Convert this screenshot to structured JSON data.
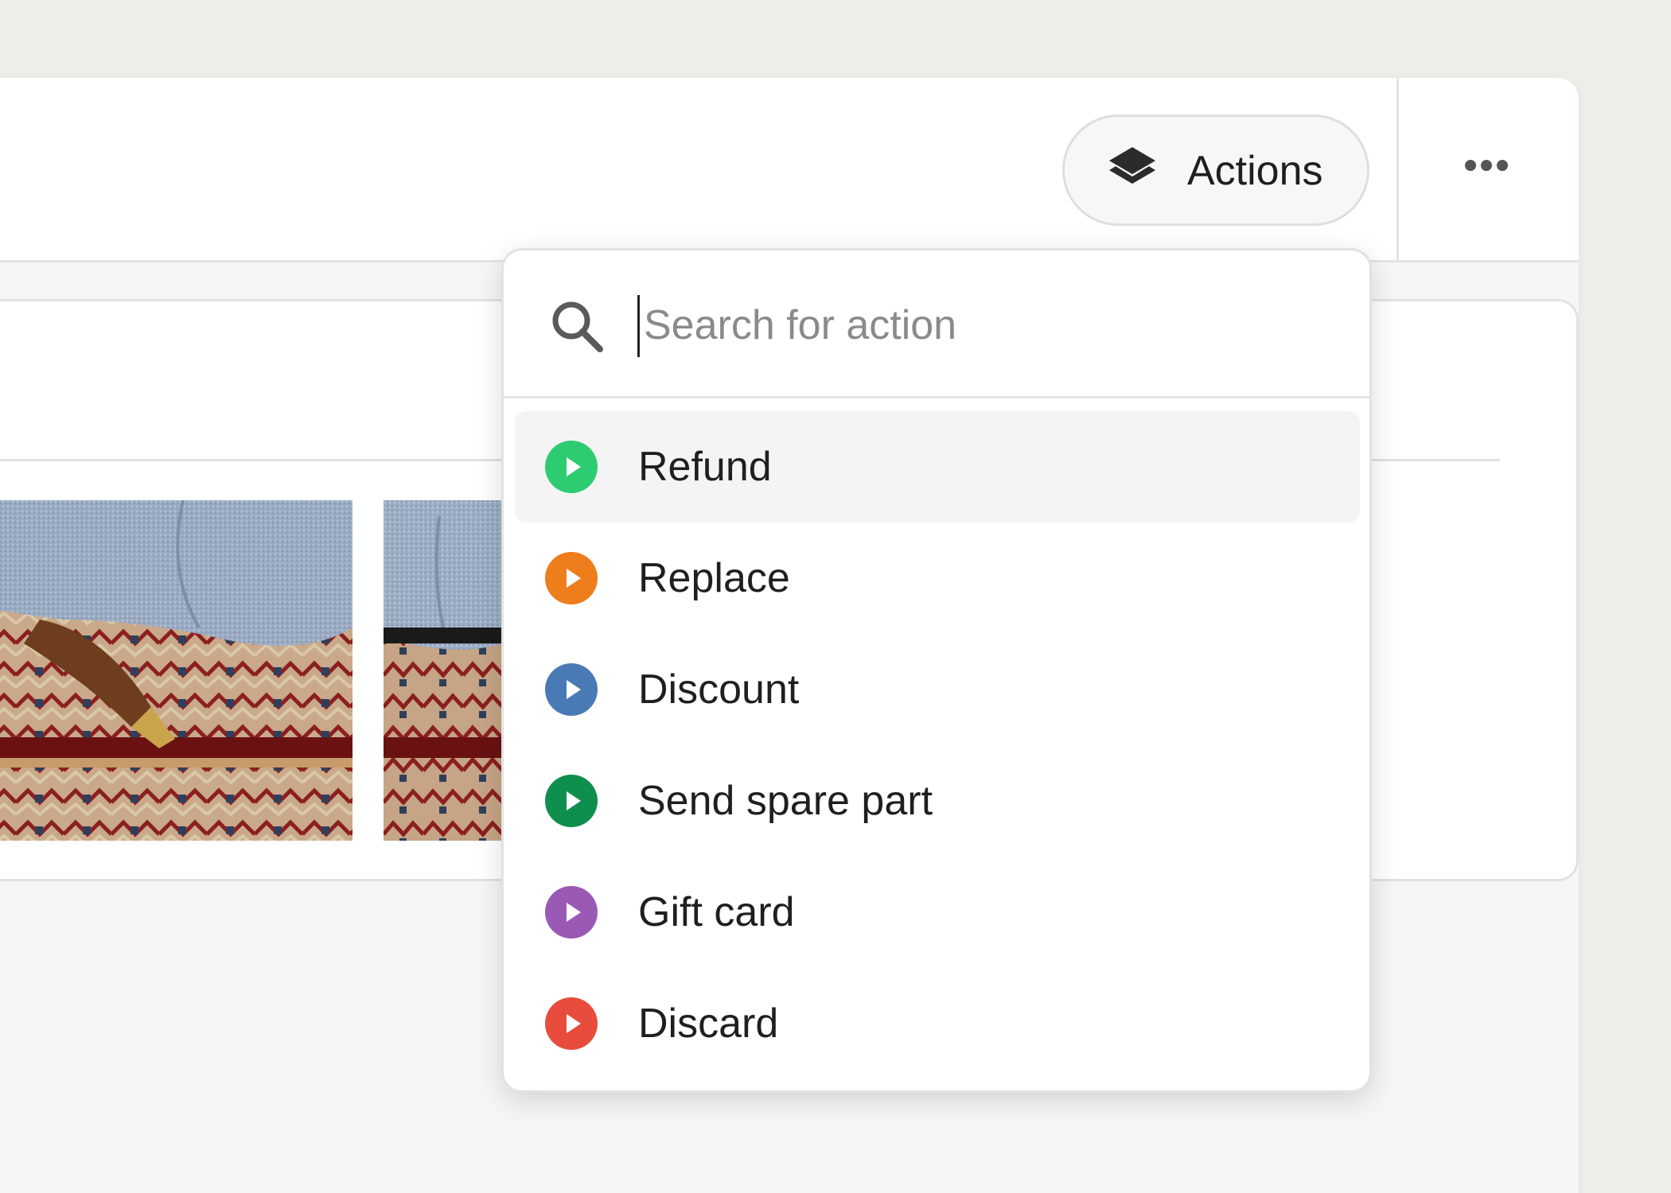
{
  "header": {
    "actions_label": "Actions",
    "actions_icon": "layers-icon",
    "more_icon": "ellipsis-icon"
  },
  "search": {
    "placeholder": "Search for action",
    "value": "",
    "icon": "search-icon"
  },
  "menu": {
    "items": [
      {
        "label": "Refund",
        "color": "#2ecc71",
        "icon": "play-icon",
        "active": true
      },
      {
        "label": "Replace",
        "color": "#ee7d1c",
        "icon": "play-icon",
        "active": false
      },
      {
        "label": "Discount",
        "color": "#4a7ab5",
        "icon": "play-icon",
        "active": false
      },
      {
        "label": "Send spare part",
        "color": "#0f8f4e",
        "icon": "play-icon",
        "active": false
      },
      {
        "label": "Gift card",
        "color": "#9b59b6",
        "icon": "play-icon",
        "active": false
      },
      {
        "label": "Discard",
        "color": "#e74c3c",
        "icon": "play-icon",
        "active": false
      }
    ]
  },
  "card": {
    "photos": [
      "sofa-leg-on-rug-photo",
      "sofa-on-rug-photo"
    ]
  }
}
